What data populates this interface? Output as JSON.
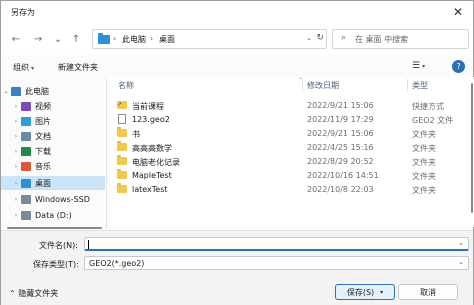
{
  "window": {
    "title": "另存为",
    "close_glyph": "✕"
  },
  "nav": {
    "back_glyph": "←",
    "forward_glyph": "→",
    "recent_glyph": "⌄",
    "up_glyph": "↑",
    "breadcrumb": [
      "此电脑",
      "桌面"
    ],
    "separator": "›",
    "dropdown_glyph": "⌄",
    "refresh_glyph": "↻",
    "search_placeholder": "在 桌面 中搜索",
    "search_glyph": "⌕"
  },
  "toolbar": {
    "organize": "组织",
    "new_folder": "新建文件夹",
    "dropdown_glyph": "▾",
    "view_glyph": "☰",
    "help_glyph": "?"
  },
  "sidebar": {
    "items": [
      {
        "label": "此电脑",
        "icon": "computer-icon",
        "color": "#3b82c4",
        "chevron": "⌄",
        "selected": false
      },
      {
        "label": "视频",
        "icon": "video-icon",
        "color": "#7b4bb7",
        "chevron": "›",
        "selected": false
      },
      {
        "label": "图片",
        "icon": "picture-icon",
        "color": "#2f9dd6",
        "chevron": "›",
        "selected": false
      },
      {
        "label": "文档",
        "icon": "document-icon",
        "color": "#6f8aa6",
        "chevron": "›",
        "selected": false
      },
      {
        "label": "下载",
        "icon": "download-icon",
        "color": "#1f8a4c",
        "chevron": "›",
        "selected": false
      },
      {
        "label": "音乐",
        "icon": "music-icon",
        "color": "#e0563b",
        "chevron": "›",
        "selected": false
      },
      {
        "label": "桌面",
        "icon": "desktop-icon",
        "color": "#2d8fd6",
        "chevron": "›",
        "selected": true
      },
      {
        "label": "Windows-SSD",
        "icon": "drive-icon",
        "color": "#7a8a99",
        "chevron": "›",
        "selected": false
      },
      {
        "label": "Data (D:)",
        "icon": "drive-icon",
        "color": "#7a8a99",
        "chevron": "›",
        "selected": false
      }
    ]
  },
  "files": {
    "columns": {
      "name": "名称",
      "modified": "修改日期",
      "type": "类型",
      "sort_glyph": "⌃"
    },
    "rows": [
      {
        "name": "当前课程",
        "date": "2022/9/21 15:06",
        "type": "快捷方式",
        "kind": "shortcut"
      },
      {
        "name": "123.geo2",
        "date": "2022/11/9 17:29",
        "type": "GEO2 文件",
        "kind": "file"
      },
      {
        "name": "书",
        "date": "2022/9/21 15:06",
        "type": "文件夹",
        "kind": "folder"
      },
      {
        "name": "高高高数学",
        "date": "2022/4/25 15:16",
        "type": "文件夹",
        "kind": "folder"
      },
      {
        "name": "电脑老化记录",
        "date": "2022/8/29 20:52",
        "type": "文件夹",
        "kind": "folder"
      },
      {
        "name": "MapleTest",
        "date": "2022/10/16 14:51",
        "type": "文件夹",
        "kind": "folder"
      },
      {
        "name": "latexTest",
        "date": "2022/10/8 22:03",
        "type": "文件夹",
        "kind": "folder"
      }
    ]
  },
  "form": {
    "filename_label": "文件名(N):",
    "filename_value": "",
    "filetype_label": "保存类型(T):",
    "filetype_value": "GEO2(*.geo2)",
    "dropdown_glyph": "⌄"
  },
  "footer": {
    "hide_folders": "隐藏文件夹",
    "hide_glyph": "⌃",
    "save": "保存(S)",
    "cancel": "取消",
    "save_glyph": "▾"
  }
}
